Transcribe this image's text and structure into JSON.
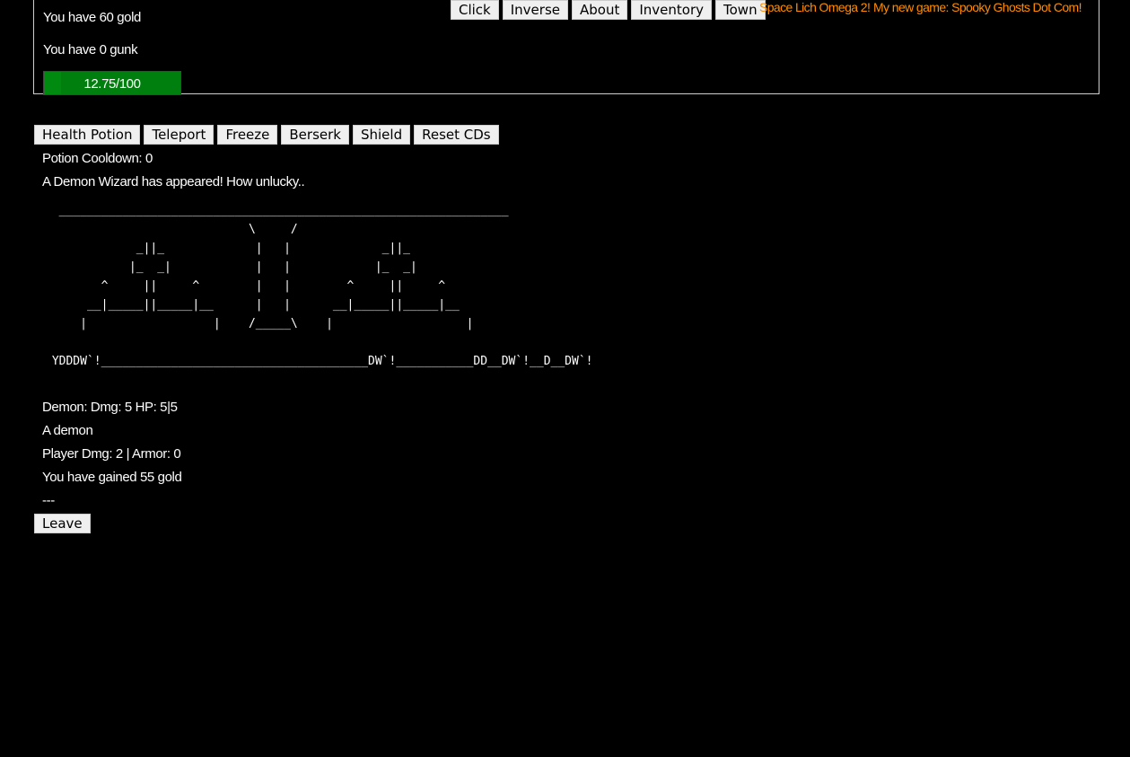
{
  "resources": {
    "gold_text": "You have 60 gold",
    "gunk_text": "You have 0 gunk",
    "progress_label": "12.75/100",
    "progress_value": 12.75,
    "progress_max": 100
  },
  "nav": {
    "buttons": [
      "Click",
      "Inverse",
      "About",
      "Inventory",
      "Town"
    ],
    "links": [
      "Space Lich Omega 2!",
      "My new game: Spooky Ghosts Dot Com!"
    ]
  },
  "actions": [
    "Health Potion",
    "Teleport",
    "Freeze",
    "Berserk",
    "Shield",
    "Reset CDs"
  ],
  "status": {
    "potion_cooldown": "Potion Cooldown: 0",
    "encounter": "A Demon Wizard has appeared! How unlucky.."
  },
  "ascii_art": "  ________________________________________________________________\n                             \\     /\n             _||_             |   |             _||_\n            |_  _|            |   |            |_  _|\n        ^     ||     ^        |   |        ^     ||     ^\n      __|_____||_____|__      |   |      __|_____||_____|__\n     |                  |    /_____\\    |                   |\n\n YDDDW`!______________________________________DW`!___________DD__DW`!__D__DW`!",
  "combat": {
    "enemy_stats": "Demon: Dmg: 5 HP: 5|5",
    "enemy_desc": "A demon",
    "player_stats": "Player Dmg: 2 | Armor: 0",
    "reward": "You have gained 55 gold",
    "separator": "---"
  },
  "leave_label": "Leave",
  "colors": {
    "background": "#000000",
    "text": "#ffffff",
    "link": "#ff8c00",
    "progress": "#008a10"
  }
}
